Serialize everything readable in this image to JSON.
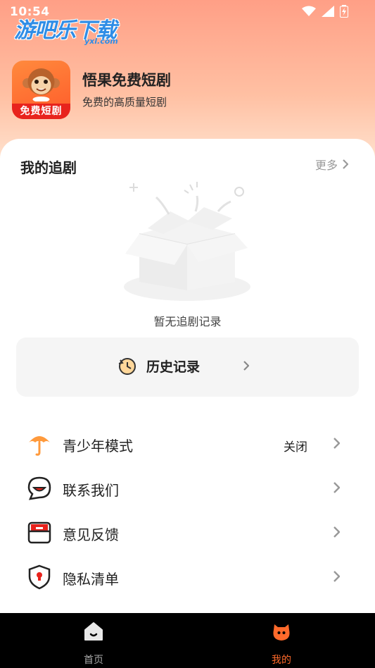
{
  "status_bar": {
    "time": "10:54"
  },
  "watermark": {
    "text": "游吧乐下载",
    "sub": "yxl.com"
  },
  "app": {
    "name": "悟果免费短剧",
    "description": "免费的高质量短剧",
    "logo_label": "免费短剧"
  },
  "my_follow": {
    "title": "我的追剧",
    "more_label": "更多",
    "empty_text": "暂无追剧记录"
  },
  "history": {
    "label": "历史记录"
  },
  "menu": {
    "items": [
      {
        "label": "青少年模式",
        "value": "关闭",
        "icon": "umbrella-icon"
      },
      {
        "label": "联系我们",
        "value": "",
        "icon": "chat-icon"
      },
      {
        "label": "意见反馈",
        "value": "",
        "icon": "feedback-icon"
      },
      {
        "label": "隐私清单",
        "value": "",
        "icon": "shield-icon"
      }
    ]
  },
  "bottom_nav": {
    "items": [
      {
        "label": "首页",
        "icon": "home-icon",
        "active": false
      },
      {
        "label": "我的",
        "icon": "profile-icon",
        "active": true
      }
    ]
  },
  "colors": {
    "accent": "#ff6a2b",
    "header_gradient_top": "#ff9f86",
    "nav_bg": "#000000"
  }
}
